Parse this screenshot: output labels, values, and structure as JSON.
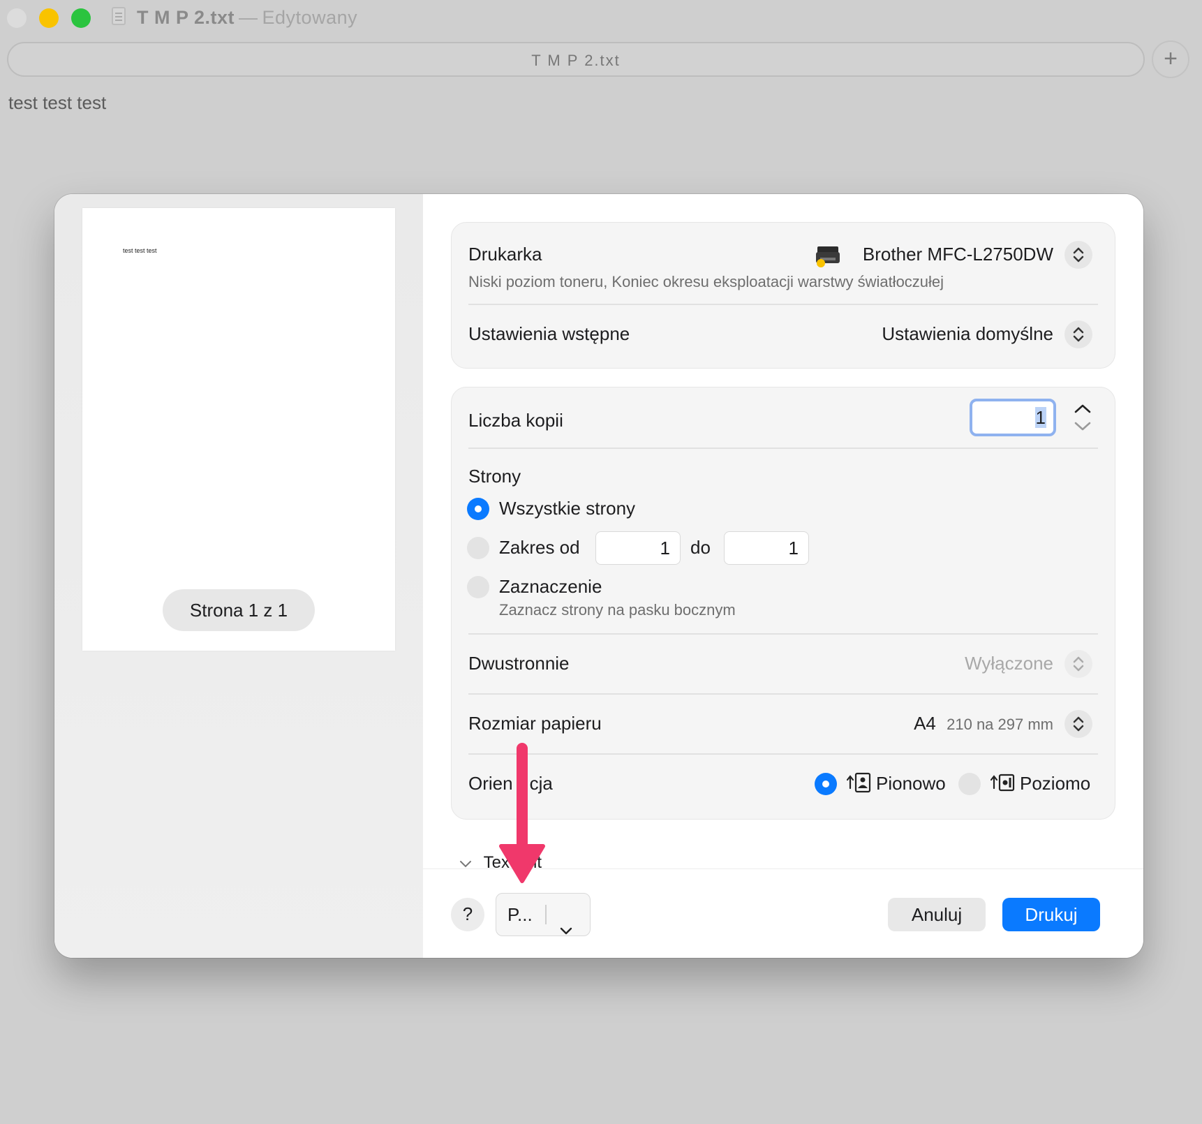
{
  "window": {
    "title": "T M P 2.txt",
    "separator": "—",
    "status": "Edytowany",
    "tab_label": "T M P 2.txt",
    "add_tab": "+",
    "document_text": "test test test"
  },
  "preview": {
    "page_text": "test test test",
    "page_indicator": "Strona 1 z 1"
  },
  "printer": {
    "label": "Drukarka",
    "name": "Brother MFC-L2750DW",
    "status": "Niski poziom toneru, Koniec okresu eksploatacji warstwy światłoczułej"
  },
  "presets": {
    "label": "Ustawienia wstępne",
    "value": "Ustawienia domyślne"
  },
  "copies": {
    "label": "Liczba kopii",
    "value": "1"
  },
  "pages": {
    "label": "Strony",
    "all_label": "Wszystkie strony",
    "range_label": "Zakres od",
    "range_from": "1",
    "range_to_label": "do",
    "range_to": "1",
    "selection_label": "Zaznaczenie",
    "selection_hint": "Zaznacz strony na pasku bocznym",
    "selected": "all"
  },
  "duplex": {
    "label": "Dwustronnie",
    "value": "Wyłączone"
  },
  "paper_size": {
    "label": "Rozmiar papieru",
    "value": "A4",
    "detail": "210 na 297 mm"
  },
  "orientation": {
    "label": "Orientacja",
    "label_visible_left": "Orien",
    "label_visible_right": "cja",
    "portrait": "Pionowo",
    "landscape": "Poziomo",
    "selected": "portrait"
  },
  "section": {
    "label_left": "Tex",
    "label_right": "it"
  },
  "footer": {
    "help": "?",
    "pdf_button": "P...",
    "cancel": "Anuluj",
    "print": "Drukuj"
  },
  "colors": {
    "accent": "#0a7aff",
    "annotation_arrow": "#f0386b",
    "traffic_min": "#f9c300",
    "traffic_max": "#2bc43f"
  }
}
